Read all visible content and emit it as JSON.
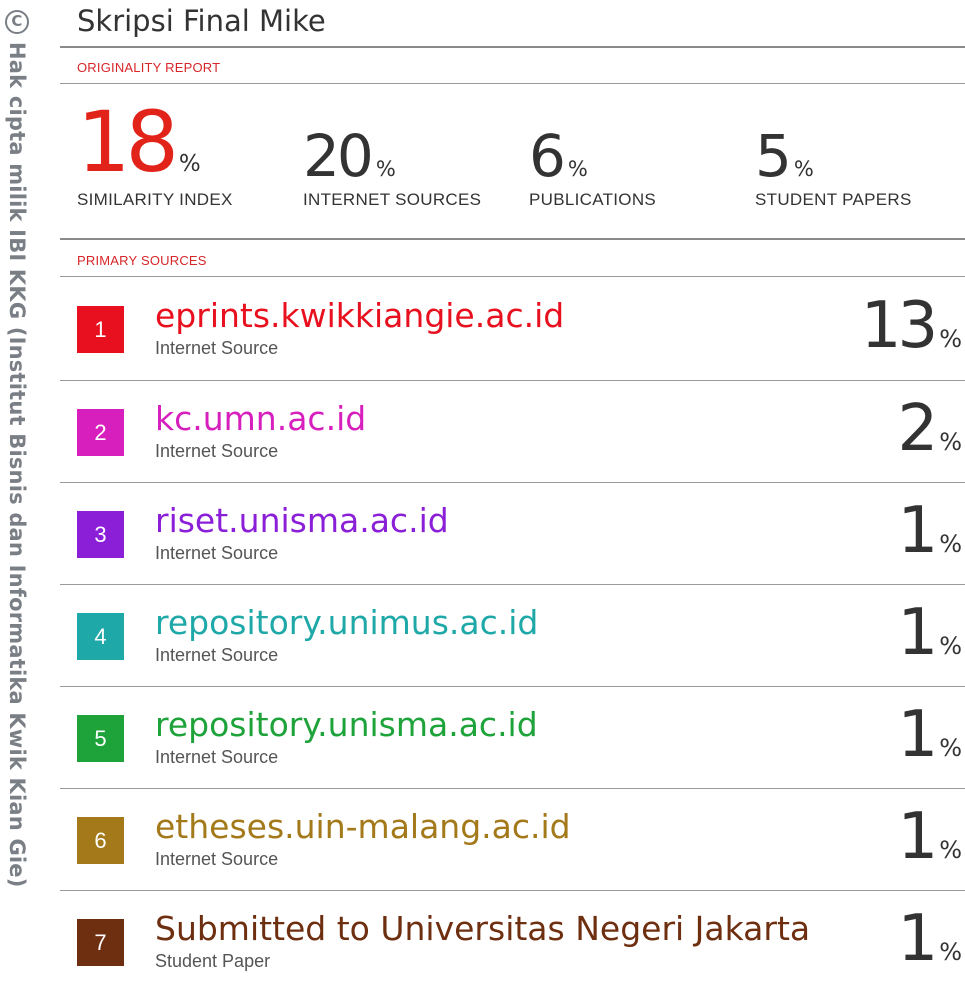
{
  "watermark": {
    "symbol": "C",
    "text": "Hak cipta milik IBI KKG (Institut Bisnis dan Informatika Kwik Kian Gie)"
  },
  "document": {
    "title": "Skripsi Final Mike"
  },
  "report": {
    "section_label": "ORIGINALITY REPORT",
    "stats": [
      {
        "value": "18",
        "unit": "%",
        "label": "SIMILARITY INDEX",
        "color": "#e2231a"
      },
      {
        "value": "20",
        "unit": "%",
        "label": "INTERNET SOURCES"
      },
      {
        "value": "6",
        "unit": "%",
        "label": "PUBLICATIONS"
      },
      {
        "value": "5",
        "unit": "%",
        "label": "STUDENT PAPERS"
      }
    ]
  },
  "primary_sources": {
    "section_label": "PRIMARY SOURCES",
    "items": [
      {
        "rank": "1",
        "name": "eprints.kwikkiangie.ac.id",
        "type": "Internet Source",
        "percent": "13",
        "unit": "%",
        "color": "#e8101e"
      },
      {
        "rank": "2",
        "name": "kc.umn.ac.id",
        "type": "Internet Source",
        "percent": "2",
        "unit": "%",
        "color": "#d71fbd"
      },
      {
        "rank": "3",
        "name": "riset.unisma.ac.id",
        "type": "Internet Source",
        "percent": "1",
        "unit": "%",
        "color": "#8b1fd8"
      },
      {
        "rank": "4",
        "name": "repository.unimus.ac.id",
        "type": "Internet Source",
        "percent": "1",
        "unit": "%",
        "color": "#1fa8a8"
      },
      {
        "rank": "5",
        "name": "repository.unisma.ac.id",
        "type": "Internet Source",
        "percent": "1",
        "unit": "%",
        "color": "#1ea33a"
      },
      {
        "rank": "6",
        "name": "etheses.uin-malang.ac.id",
        "type": "Internet Source",
        "percent": "1",
        "unit": "%",
        "color": "#a3791a"
      },
      {
        "rank": "7",
        "name": "Submitted to Universitas Negeri Jakarta",
        "type": "Student Paper",
        "percent": "1",
        "unit": "%",
        "color": "#6e2e10"
      }
    ]
  }
}
